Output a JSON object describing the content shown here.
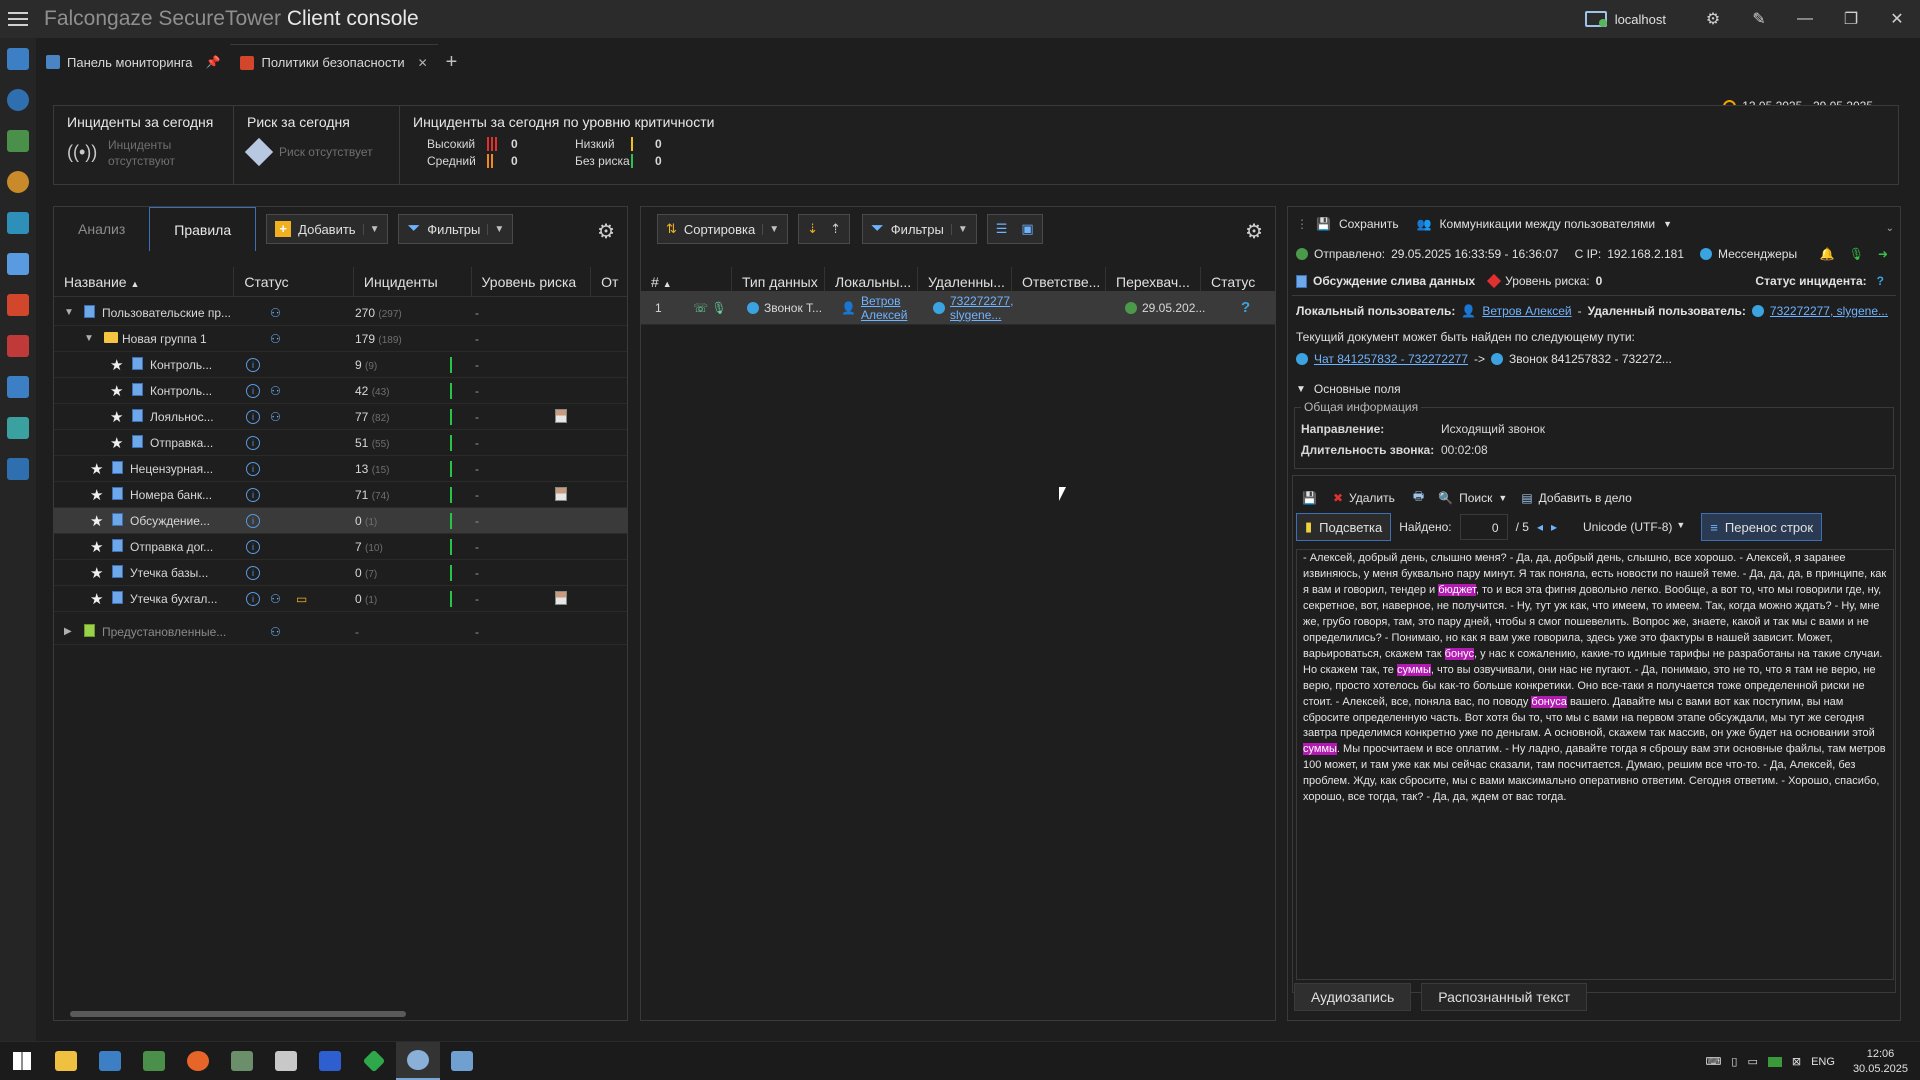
{
  "app": {
    "title_product": "Falcongaze SecureTower",
    "title_suffix": "Client console",
    "host": "localhost"
  },
  "tabs": [
    {
      "label": "Панель мониторинга"
    },
    {
      "label": "Политики безопасности"
    }
  ],
  "summary": {
    "incidents_today": {
      "title": "Инциденты за сегодня",
      "status": "Инциденты отсутствуют"
    },
    "risk_today": {
      "title": "Риск за сегодня",
      "status": "Риск отсутствует"
    },
    "by_criticality": {
      "title": "Инциденты за сегодня по уровню критичности",
      "high_label": "Высокий",
      "high_value": "0",
      "medium_label": "Средний",
      "medium_value": "0",
      "low_label": "Низкий",
      "low_value": "0",
      "norisk_label": "Без риска",
      "norisk_value": "0"
    },
    "date_range": "12.05.2025 - 29.05.2025"
  },
  "left_panel": {
    "tab_analysis": "Анализ",
    "tab_rules": "Правила",
    "add_label": "Добавить",
    "filters_label": "Фильтры",
    "columns": [
      "Название",
      "Статус",
      "Инциденты",
      "Уровень риска",
      "От"
    ],
    "rows": [
      {
        "name": "Пользовательские пр...",
        "count": "270",
        "sub": "(297)",
        "risk": "-"
      },
      {
        "name": "Новая группа 1",
        "count": "179",
        "sub": "(189)",
        "risk": "-"
      },
      {
        "name": "Контроль...",
        "count": "9",
        "sub": "(9)",
        "risk": "-"
      },
      {
        "name": "Контроль...",
        "count": "42",
        "sub": "(43)",
        "risk": "-"
      },
      {
        "name": "Лояльнос...",
        "count": "77",
        "sub": "(82)",
        "risk": "-"
      },
      {
        "name": "Отправка...",
        "count": "51",
        "sub": "(55)",
        "risk": "-"
      },
      {
        "name": "Нецензурная...",
        "count": "13",
        "sub": "(15)",
        "risk": "-"
      },
      {
        "name": "Номера банк...",
        "count": "71",
        "sub": "(74)",
        "risk": "-"
      },
      {
        "name": "Обсуждение...",
        "count": "0",
        "sub": "(1)",
        "risk": "-"
      },
      {
        "name": "Отправка дог...",
        "count": "7",
        "sub": "(10)",
        "risk": "-"
      },
      {
        "name": "Утечка базы...",
        "count": "0",
        "sub": "(7)",
        "risk": "-"
      },
      {
        "name": "Утечка бухгал...",
        "count": "0",
        "sub": "(1)",
        "risk": "-"
      },
      {
        "name": "Предустановленные...",
        "count": "-",
        "sub": "",
        "risk": "-"
      }
    ]
  },
  "middle_panel": {
    "sort_label": "Сортировка",
    "filters_label": "Фильтры",
    "columns": [
      "#",
      "Тип данных",
      "Локальны...",
      "Удаленны...",
      "Ответстве...",
      "Перехвач...",
      "Статус"
    ],
    "rows": [
      {
        "num": "1",
        "type": "Звонок Т...",
        "local": "Ветров Алексей",
        "remote": "732272277, slygene...",
        "intercepted": "29.05.202...",
        "status": "?"
      }
    ]
  },
  "right_panel": {
    "save_label": "Сохранить",
    "comm_label": "Коммуникации между пользователями",
    "sent_label": "Отправлено:",
    "sent_value": "29.05.2025 16:33:59 - 16:36:07",
    "ip_label": "С IP:",
    "ip_value": "192.168.2.181",
    "channel": "Мессенджеры",
    "policy": "Обсуждение слива данных",
    "risk_label": "Уровень риска:",
    "risk_value": "0",
    "incident_status_label": "Статус инцидента:",
    "local_user_label": "Локальный пользователь:",
    "local_user": "Ветров Алексей",
    "remote_user_label": "Удаленный пользователь:",
    "remote_user": "732272277, slygene...",
    "path_text": "Текущий документ может быть найден по следующему пути:",
    "path_chat": "Чат 841257832 - 732272277",
    "path_arrow": "->",
    "path_call": "Звонок 841257832 - 732272...",
    "section_main": "Основные поля",
    "group_general": "Общая информация",
    "direction_label": "Направление:",
    "direction_value": "Исходящий звонок",
    "duration_label": "Длительность звонка:",
    "duration_value": "00:02:08",
    "delete_label": "Удалить",
    "search_label": "Поиск",
    "add_case_label": "Добавить в дело",
    "highlight_label": "Подсветка",
    "found_label": "Найдено:",
    "found_value": "0",
    "found_total": "/ 5",
    "encoding": "Unicode (UTF-8)",
    "wrap_label": "Перенос строк",
    "transcript": [
      {
        "t": " - Алексей, добрый день, слышно меня? - Да, да, добрый день, слышно, все хорошо. - Алексей, я заранее извиняюсь, у меня буквально пару минут. Я так поняла, есть новости по нашей теме. - Да, да, да, в принципе, как я вам и говорил, тендер и "
      },
      {
        "h": "бюджет"
      },
      {
        "t": ", то и вся эта фигня довольно легко. Вообще, а вот то, что мы говорили где, ну, секретное, вот, наверное, не получится. - Ну, тут уж как, что имеем, то имеем. Так, когда можно ждать? - Ну, мне же, грубо говоря, там, это пару дней, чтобы я смог пошевелить. Вопрос же, знаете, какой и так мы с вами и не определились? - Понимаю, но как я вам уже говорила, здесь уже это фактуры в нашей зависит. Может, варьироваться, скажем так "
      },
      {
        "h": "бонус"
      },
      {
        "t": ", у нас к сожалению, какие-то идиные тарифы не разработаны на такие случаи. Но скажем так, те "
      },
      {
        "h": "суммы"
      },
      {
        "t": ", что вы озвучивали, они нас не пугают. - Да, понимаю, это не то, что я там не верю, не верю, просто хотелось бы как-то больше конкретики. Оно все-таки я получается тоже определенной риски не стоит. - Алексей, все, поняла вас, по поводу "
      },
      {
        "h": "бонуса"
      },
      {
        "t": " вашего. Давайте мы с вами вот как поступим, вы нам сбросите определенную часть. Вот хотя бы то, что мы с вами на первом этапе обсуждали, мы тут же сегодня завтра предели­мся конкретно уже по деньгам. А основной, скажем так массив, он уже будет на основании этой "
      },
      {
        "h": "суммы"
      },
      {
        "t": ". Мы просчитаем и все оплатим. - Ну ладно, давайте тогда я сброшу вам эти основные файлы, там метров 100 может, и там уже как мы сейчас сказали, там посчитается. Думаю, решим все что-то. - Да, Алексей, без проблем. Жду, как сбросите, мы с вами максимально оперативно ответим. Сегодня ответим. - Хорошо, спасибо, хорошо, все тогда, так? - Да, да, ждем от вас тогда."
      }
    ],
    "tab_audio": "Аудиозапись",
    "tab_text": "Распознанный текст"
  },
  "taskbar": {
    "lang": "ENG",
    "time": "12:06",
    "date": "30.05.2025"
  }
}
